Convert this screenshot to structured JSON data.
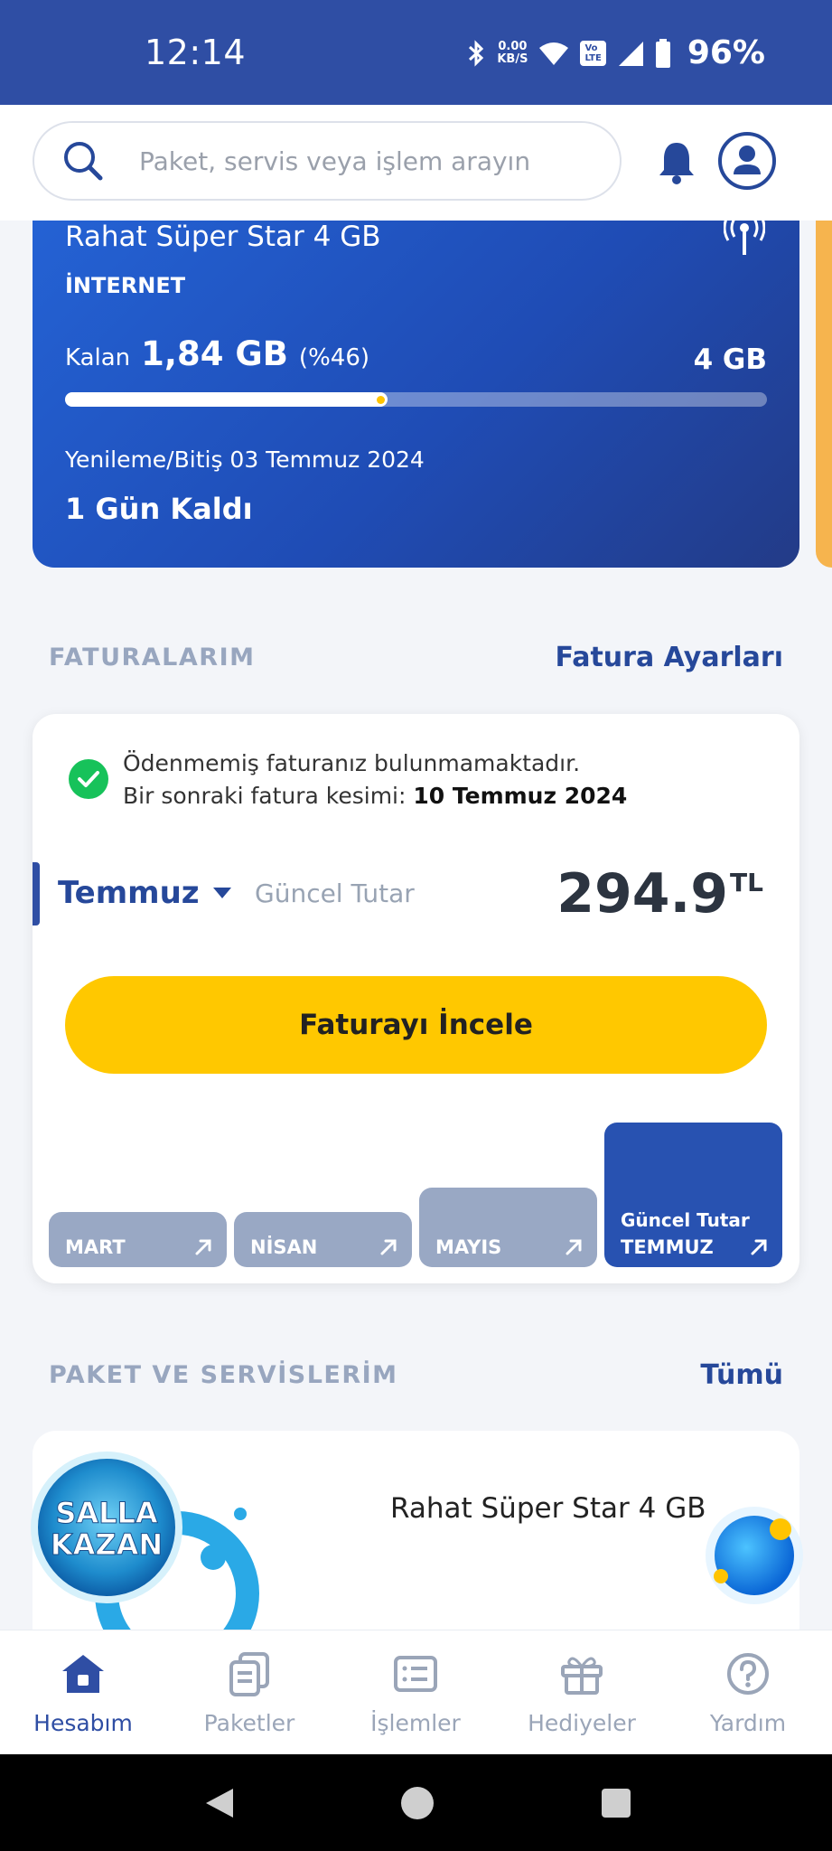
{
  "status_bar": {
    "time": "12:14",
    "net_speed_value": "0.00",
    "net_speed_unit": "KB/S",
    "volte_top": "Vo",
    "volte_bottom": "LTE",
    "battery": "96%"
  },
  "search": {
    "placeholder": "Paket, servis veya işlem arayın"
  },
  "data_card": {
    "package_name": "Rahat Süper Star 4 GB",
    "type": "İNTERNET",
    "remaining_prefix": "Kalan",
    "remaining_value": "1,84 GB",
    "remaining_percent": "(%46)",
    "remaining_fraction": 0.46,
    "total": "4 GB",
    "renewal": "Yenileme/Bitiş 03 Temmuz 2024",
    "days_left": "1 Gün Kaldı"
  },
  "invoices": {
    "section_title": "FATURALARIM",
    "settings_link": "Fatura Ayarları",
    "message_line1": "Ödenmemiş faturanız bulunmamaktadır.",
    "message_line2_prefix": "Bir sonraki fatura kesimi:",
    "message_line2_date": "10 Temmuz 2024",
    "selected_month": "Temmuz",
    "current_label": "Güncel Tutar",
    "amount": "294.9",
    "currency": "TL",
    "review_button": "Faturayı İncele",
    "bars": [
      {
        "label": "MART",
        "sub": "",
        "level": 0.38
      },
      {
        "label": "NİSAN",
        "sub": "",
        "level": 0.38
      },
      {
        "label": "MAYIS",
        "sub": "",
        "level": 0.55
      },
      {
        "label": "TEMMUZ",
        "sub": "Güncel Tutar",
        "level": 1.0,
        "active": true
      }
    ]
  },
  "packages": {
    "section_title": "PAKET VE SERVİSLERİM",
    "all_link": "Tümü",
    "item_name": "Rahat Süper Star 4 GB"
  },
  "promo": {
    "line1": "SALLA",
    "line2": "KAZAN"
  },
  "bottom_nav": [
    {
      "label": "Hesabım",
      "icon": "home-icon",
      "active": true
    },
    {
      "label": "Paketler",
      "icon": "packages-icon"
    },
    {
      "label": "İşlemler",
      "icon": "list-icon"
    },
    {
      "label": "Hediyeler",
      "icon": "gift-icon"
    },
    {
      "label": "Yardım",
      "icon": "help-icon"
    }
  ],
  "colors": {
    "primary": "#2f4ea4",
    "accent": "#ffc800",
    "success": "#17c25a"
  }
}
